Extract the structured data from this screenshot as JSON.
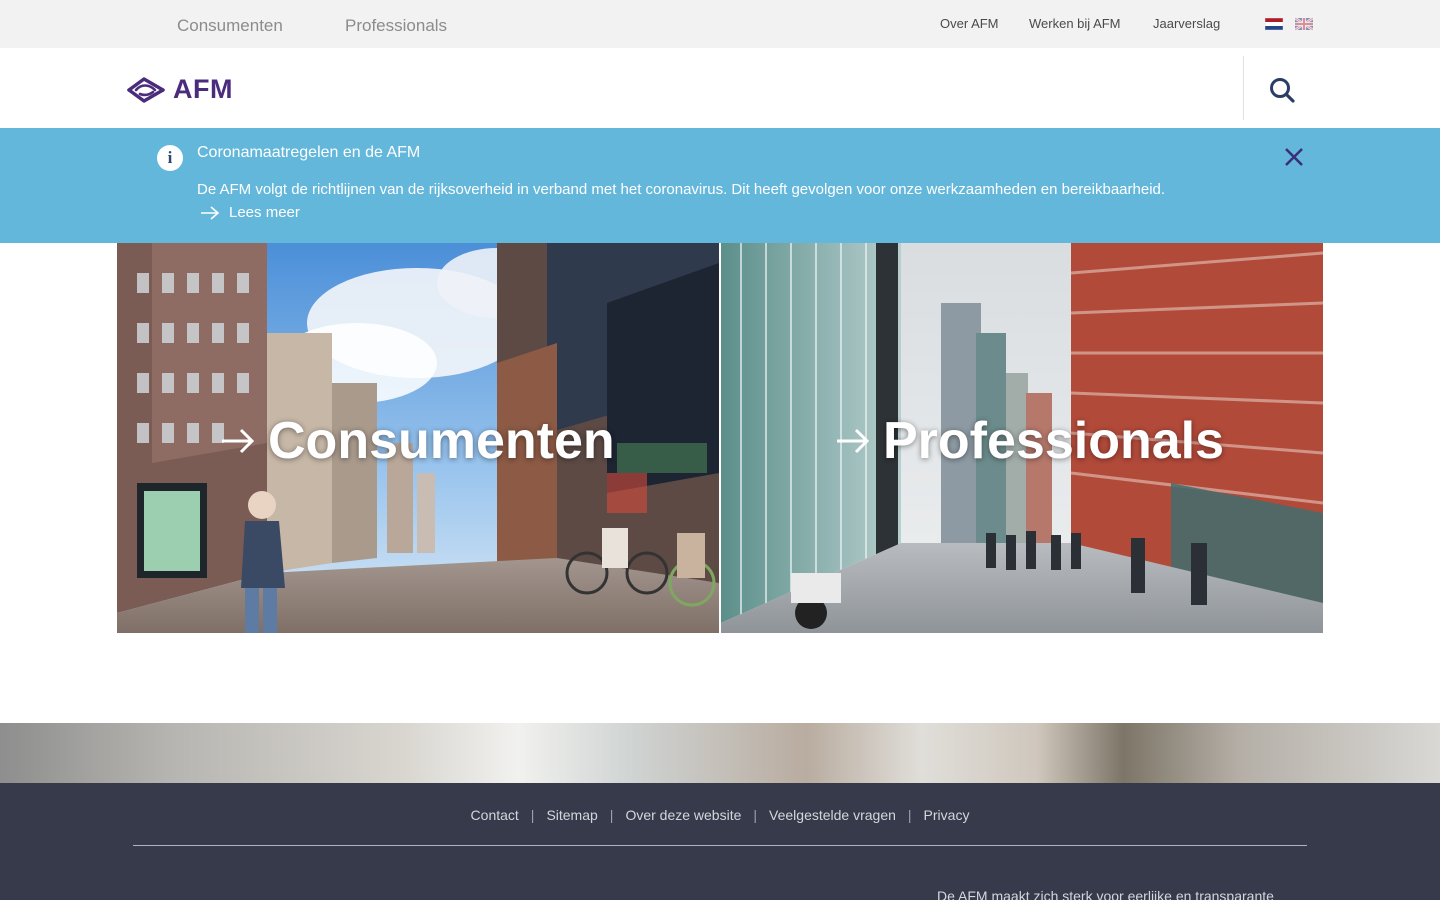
{
  "topbar": {
    "audiences": [
      "Consumenten",
      "Professionals"
    ],
    "utility_links": [
      "Over AFM",
      "Werken bij AFM",
      "Jaarverslag"
    ],
    "languages": [
      "nl-flag",
      "en-flag"
    ]
  },
  "header": {
    "logo_text": "AFM",
    "search_icon": "search-icon"
  },
  "notice": {
    "icon": "info-icon",
    "title": "Coronamaatregelen en de AFM",
    "body": "De AFM volgt de richtlijnen van de rijksoverheid in verband met het coronavirus. Dit heeft gevolgen voor onze werkzaamheden en bereikbaarheid.",
    "link_label": "Lees meer",
    "close_icon": "close-icon"
  },
  "tiles": [
    {
      "label": "Consumenten",
      "icon": "arrow-right-icon"
    },
    {
      "label": "Professionals",
      "icon": "arrow-right-icon"
    }
  ],
  "footer": {
    "links": [
      "Contact",
      "Sitemap",
      "Over deze website",
      "Veelgestelde vragen",
      "Privacy"
    ],
    "tagline": "De AFM maakt zich sterk voor eerlijke en transparante"
  },
  "colors": {
    "brand_purple": "#4b2c7c",
    "notice_blue": "#63b7db",
    "footer_bg": "#363a4a",
    "topbar_bg": "#f2f2f2"
  }
}
